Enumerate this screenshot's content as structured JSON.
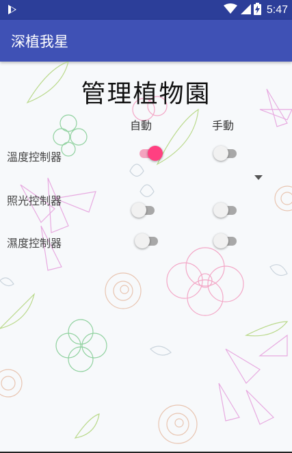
{
  "status_bar": {
    "time": "5:47"
  },
  "app_bar": {
    "title": "深植我星"
  },
  "main": {
    "title": "管理植物園",
    "columns": {
      "auto": "自動",
      "manual": "手動"
    },
    "rows": [
      {
        "label": "溫度控制器",
        "auto_on": true,
        "manual_on": false
      },
      {
        "label": "照光控制器",
        "auto_on": false,
        "manual_on": false
      },
      {
        "label": "濕度控制器",
        "auto_on": false,
        "manual_on": false
      }
    ]
  },
  "colors": {
    "status_bar": "#2c3e99",
    "app_bar": "#3f51b5",
    "accent": "#ff4081"
  }
}
